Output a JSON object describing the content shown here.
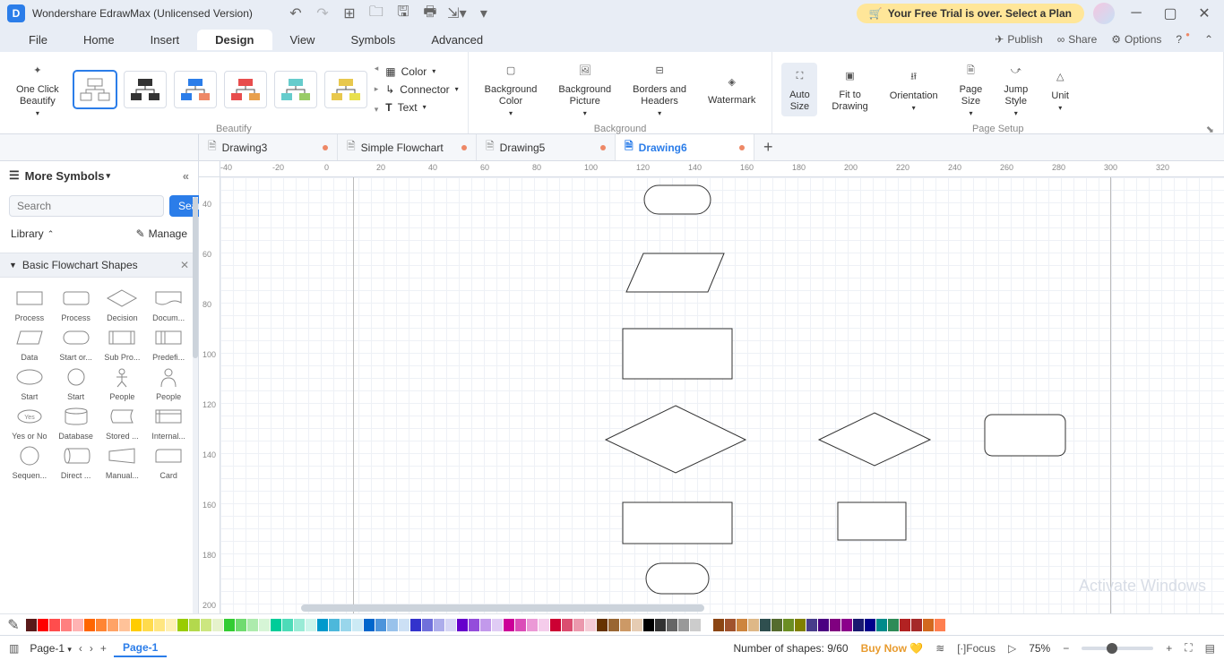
{
  "title": "Wondershare EdrawMax (Unlicensed Version)",
  "trial_banner": "Your Free Trial is over. Select a Plan",
  "menu": {
    "file": "File",
    "home": "Home",
    "insert": "Insert",
    "design": "Design",
    "view": "View",
    "symbols": "Symbols",
    "advanced": "Advanced",
    "publish": "Publish",
    "share": "Share",
    "options": "Options"
  },
  "ribbon": {
    "beautify_btn": "One Click\nBeautify",
    "group_beautify": "Beautify",
    "color": "Color",
    "connector": "Connector",
    "text": "Text",
    "bg_color": "Background\nColor",
    "bg_pic": "Background\nPicture",
    "borders": "Borders and\nHeaders",
    "watermark": "Watermark",
    "group_background": "Background",
    "auto_size": "Auto\nSize",
    "fit": "Fit to\nDrawing",
    "orientation": "Orientation",
    "page_size": "Page\nSize",
    "jump_style": "Jump\nStyle",
    "unit": "Unit",
    "group_page": "Page Setup"
  },
  "tabs": [
    {
      "label": "Drawing3",
      "active": false
    },
    {
      "label": "Simple Flowchart",
      "active": false
    },
    {
      "label": "Drawing5",
      "active": false
    },
    {
      "label": "Drawing6",
      "active": true
    }
  ],
  "sidebar": {
    "title": "More Symbols",
    "search_placeholder": "Search",
    "search_btn": "Search",
    "library": "Library",
    "manage": "Manage",
    "category": "Basic Flowchart Shapes",
    "shapes": [
      "Process",
      "Process",
      "Decision",
      "Docum...",
      "Data",
      "Start or...",
      "Sub Pro...",
      "Predefi...",
      "Start",
      "Start",
      "People",
      "People",
      "Yes or No",
      "Database",
      "Stored ...",
      "Internal...",
      "Sequen...",
      "Direct ...",
      "Manual...",
      "Card"
    ]
  },
  "ruler_h": [
    "-40",
    "-20",
    "0",
    "20",
    "40",
    "60",
    "80",
    "100",
    "120",
    "140",
    "160",
    "180",
    "200",
    "220",
    "240",
    "260",
    "280",
    "300",
    "320"
  ],
  "ruler_v": [
    "40",
    "60",
    "80",
    "100",
    "120",
    "140",
    "160",
    "180",
    "200"
  ],
  "watermark_text": "Activate Windows",
  "status": {
    "page_selector": "Page-1",
    "page_tab": "Page-1",
    "shapes": "Number of shapes: 9/60",
    "buy": "Buy Now",
    "focus": "Focus",
    "zoom": "75%"
  },
  "colors": [
    "#5a1a1a",
    "#ff0000",
    "#ff4d4d",
    "#ff8080",
    "#ffb3b3",
    "#ff6600",
    "#ff8533",
    "#ffa366",
    "#ffc299",
    "#ffcc00",
    "#ffdb4d",
    "#ffe680",
    "#fff0b3",
    "#99cc00",
    "#b3d94d",
    "#ccE680",
    "#e6f2cc",
    "#33cc33",
    "#70db70",
    "#adebad",
    "#d6f5d6",
    "#00cc99",
    "#4ddbb8",
    "#99ebd6",
    "#ccf5eb",
    "#0099cc",
    "#4db8db",
    "#99d6eb",
    "#cceaf5",
    "#0066cc",
    "#4d94db",
    "#99c2eb",
    "#cce0f5",
    "#3333cc",
    "#7070db",
    "#adadeb",
    "#d6d6f5",
    "#6600cc",
    "#944ddb",
    "#c299eb",
    "#e0ccf5",
    "#cc0099",
    "#db4db8",
    "#eb99d6",
    "#f5cceb",
    "#cc0033",
    "#db4d70",
    "#eb99ad",
    "#f5ccd6",
    "#663300",
    "#996633",
    "#cc9966",
    "#e6ccb3",
    "#000000",
    "#333333",
    "#666666",
    "#999999",
    "#cccccc",
    "#ffffff",
    "#8b4513",
    "#a0522d",
    "#cd853f",
    "#deb887",
    "#2f4f4f",
    "#556b2f",
    "#6b8e23",
    "#808000",
    "#483d8b",
    "#4b0082",
    "#800080",
    "#8b008b",
    "#191970",
    "#00008b",
    "#008b8b",
    "#2e8b57",
    "#b22222",
    "#a52a2a",
    "#d2691e",
    "#ff7f50"
  ]
}
